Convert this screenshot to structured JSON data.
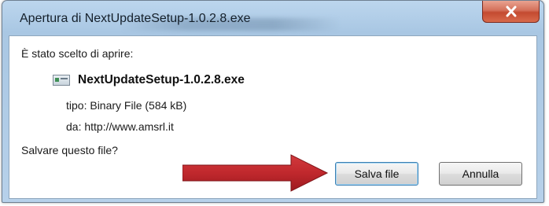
{
  "window": {
    "title": "Apertura di NextUpdateSetup-1.0.2.8.exe",
    "close_symbol": "×"
  },
  "dialog": {
    "intro": "È stato scelto di aprire:",
    "filename": "NextUpdateSetup-1.0.2.8.exe",
    "file_icon": "exe-file-icon",
    "type_line": "tipo:  Binary File (584 kB)",
    "source_line": "da:  http://www.amsrl.it",
    "question": "Salvare questo file?",
    "annotation": "red-arrow-pointing-right"
  },
  "buttons": {
    "save_label": "Salva file",
    "cancel_label": "Annulla"
  },
  "colors": {
    "title_bar": "#b7d1ea",
    "close_button": "#c44a30",
    "arrow": "#c0282d",
    "primary_button_border": "#3c7fb1"
  }
}
